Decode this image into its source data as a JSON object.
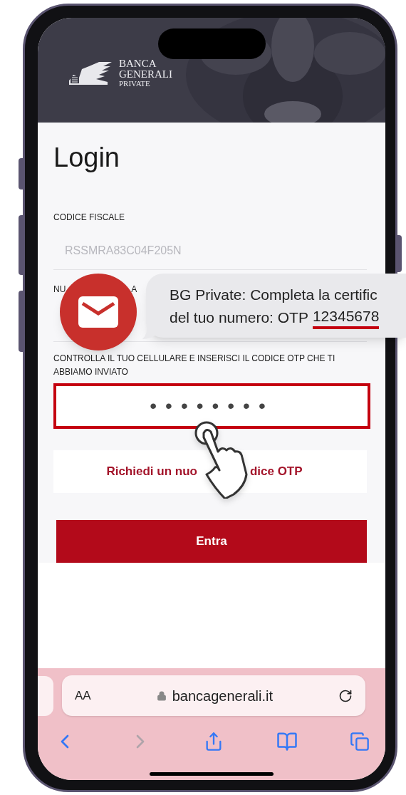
{
  "header": {
    "logo": {
      "line1": "BANCA",
      "line2": "GENERALI",
      "line3": "PRIVATE"
    }
  },
  "page": {
    "title": "Login",
    "fields": [
      {
        "label_parts": [
          "CODICE FISCALE"
        ],
        "value": "RSSMRA83C04F205N"
      },
      {
        "label_parts": [
          "NU",
          "A"
        ]
      }
    ],
    "otp_label": "CONTROLLA IL TUO CELLULARE E INSERISCI IL CODICE OTP CHE TI ABBIAMO INVIATO",
    "otp_value": "••••••••",
    "otp_highlighted": true,
    "resend_parts": [
      "Richiedi un nuo",
      "dice OTP"
    ],
    "submit": "Entra"
  },
  "sms": {
    "line1": "BG Private: Completa la certific",
    "line2": "del tuo numero: OTP",
    "code": "12345678"
  },
  "browser": {
    "text_size": "AA",
    "url": "bancagenerali.it",
    "forward_disabled": true
  }
}
